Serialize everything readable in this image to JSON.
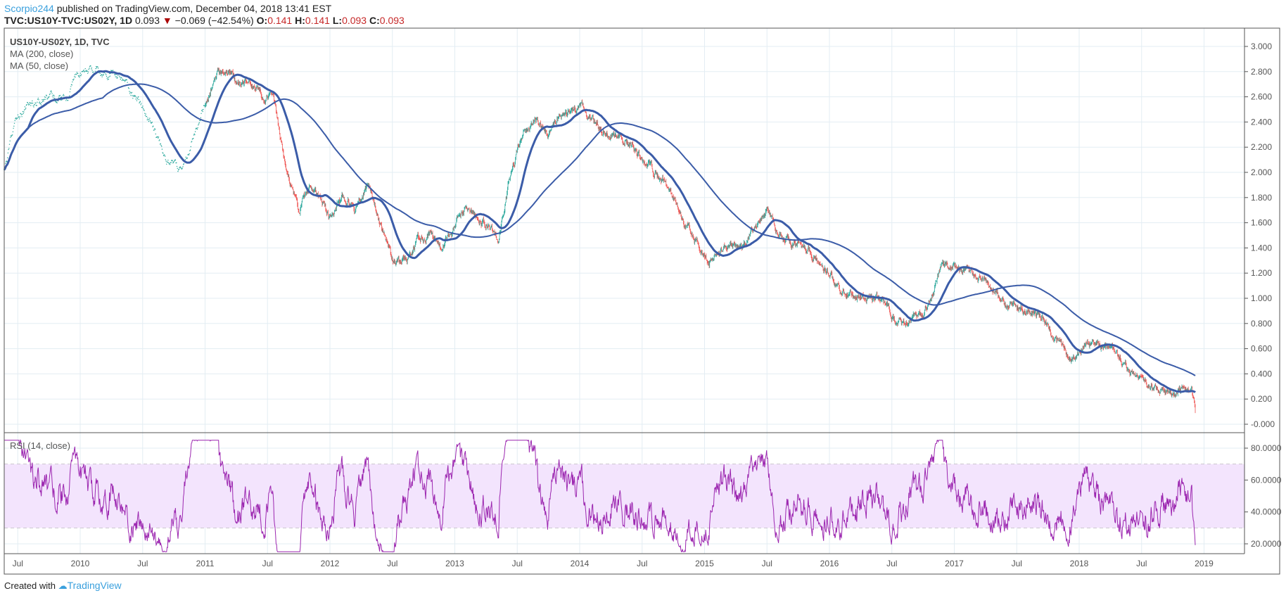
{
  "header": {
    "author": "Scorpio244",
    "published": "published on TradingView.com, December 04, 2018 13:41 EST",
    "symbol": "TVC:US10Y-TVC:US02Y, 1D",
    "last": "0.093",
    "change": "−0.069 (−42.54%)",
    "o_label": "O:",
    "o": "0.141",
    "h_label": "H:",
    "h": "0.141",
    "l_label": "L:",
    "l": "0.093",
    "c_label": "C:",
    "c": "0.093"
  },
  "legend": {
    "main": "US10Y-US02Y, 1D, TVC",
    "ma200": "MA (200, close)",
    "ma50": "MA (50, close)",
    "rsi": "RSI (14, close)"
  },
  "footer": {
    "created": "Created with",
    "brand": "TradingView"
  },
  "colors": {
    "up": "#26a69a",
    "down": "#ef5350",
    "ma": "#3b5ca8",
    "rsi": "#9c27b0",
    "band": "#f3e4fd",
    "grid": "#e3edf3"
  },
  "chart_data": {
    "type": "candlestick",
    "title": "US10Y-US02Y, 1D, TVC",
    "price_ticks": [
      "3.000",
      "2.800",
      "2.600",
      "2.400",
      "2.200",
      "2.000",
      "1.800",
      "1.600",
      "1.400",
      "1.200",
      "1.000",
      "0.800",
      "0.600",
      "0.400",
      "0.200",
      "-0.000"
    ],
    "rsi_ticks": [
      "80.0000",
      "60.0000",
      "40.0000",
      "20.0000"
    ],
    "rsi_band": [
      30,
      70
    ],
    "ylim": [
      0,
      3
    ],
    "time_ticks": [
      {
        "t": 2009.5,
        "label": "Jul"
      },
      {
        "t": 2010,
        "label": "2010"
      },
      {
        "t": 2010.5,
        "label": "Jul"
      },
      {
        "t": 2011,
        "label": "2011"
      },
      {
        "t": 2011.5,
        "label": "Jul"
      },
      {
        "t": 2012,
        "label": "2012"
      },
      {
        "t": 2012.5,
        "label": "Jul"
      },
      {
        "t": 2013,
        "label": "2013"
      },
      {
        "t": 2013.5,
        "label": "Jul"
      },
      {
        "t": 2014,
        "label": "2014"
      },
      {
        "t": 2014.5,
        "label": "Jul"
      },
      {
        "t": 2015,
        "label": "2015"
      },
      {
        "t": 2015.5,
        "label": "Jul"
      },
      {
        "t": 2016,
        "label": "2016"
      },
      {
        "t": 2016.5,
        "label": "Jul"
      },
      {
        "t": 2017,
        "label": "2017"
      },
      {
        "t": 2017.5,
        "label": "Jul"
      },
      {
        "t": 2018,
        "label": "2018"
      },
      {
        "t": 2018.5,
        "label": "Jul"
      },
      {
        "t": 2019,
        "label": "2019"
      }
    ],
    "close_path": [
      [
        2009.39,
        2.0
      ],
      [
        2009.5,
        2.45
      ],
      [
        2009.6,
        2.55
      ],
      [
        2009.9,
        2.6
      ],
      [
        2010.0,
        2.8
      ],
      [
        2010.3,
        2.8
      ],
      [
        2010.5,
        2.5
      ],
      [
        2010.7,
        2.1
      ],
      [
        2010.8,
        2.0
      ],
      [
        2010.95,
        2.4
      ],
      [
        2011.1,
        2.8
      ],
      [
        2011.3,
        2.7
      ],
      [
        2011.5,
        2.6
      ],
      [
        2011.55,
        2.6
      ],
      [
        2011.65,
        2.0
      ],
      [
        2011.75,
        1.7
      ],
      [
        2011.85,
        1.9
      ],
      [
        2012.0,
        1.65
      ],
      [
        2012.1,
        1.8
      ],
      [
        2012.2,
        1.7
      ],
      [
        2012.3,
        1.9
      ],
      [
        2012.4,
        1.6
      ],
      [
        2012.5,
        1.3
      ],
      [
        2012.6,
        1.3
      ],
      [
        2012.7,
        1.45
      ],
      [
        2012.8,
        1.5
      ],
      [
        2012.9,
        1.4
      ],
      [
        2013.0,
        1.6
      ],
      [
        2013.1,
        1.7
      ],
      [
        2013.25,
        1.6
      ],
      [
        2013.35,
        1.5
      ],
      [
        2013.45,
        2.0
      ],
      [
        2013.55,
        2.3
      ],
      [
        2013.65,
        2.4
      ],
      [
        2013.75,
        2.3
      ],
      [
        2013.85,
        2.45
      ],
      [
        2014.0,
        2.55
      ],
      [
        2014.1,
        2.4
      ],
      [
        2014.2,
        2.35
      ],
      [
        2014.35,
        2.25
      ],
      [
        2014.45,
        2.2
      ],
      [
        2014.55,
        2.05
      ],
      [
        2014.7,
        1.9
      ],
      [
        2014.8,
        1.7
      ],
      [
        2014.9,
        1.5
      ],
      [
        2015.05,
        1.3
      ],
      [
        2015.15,
        1.4
      ],
      [
        2015.3,
        1.4
      ],
      [
        2015.45,
        1.6
      ],
      [
        2015.5,
        1.7
      ],
      [
        2015.6,
        1.5
      ],
      [
        2015.7,
        1.45
      ],
      [
        2015.8,
        1.4
      ],
      [
        2015.9,
        1.3
      ],
      [
        2016.0,
        1.2
      ],
      [
        2016.1,
        1.05
      ],
      [
        2016.25,
        1.0
      ],
      [
        2016.4,
        1.0
      ],
      [
        2016.5,
        0.85
      ],
      [
        2016.6,
        0.8
      ],
      [
        2016.7,
        0.85
      ],
      [
        2016.8,
        0.95
      ],
      [
        2016.9,
        1.25
      ],
      [
        2017.0,
        1.25
      ],
      [
        2017.15,
        1.2
      ],
      [
        2017.3,
        1.1
      ],
      [
        2017.4,
        0.95
      ],
      [
        2017.55,
        0.9
      ],
      [
        2017.7,
        0.85
      ],
      [
        2017.8,
        0.7
      ],
      [
        2017.95,
        0.55
      ],
      [
        2018.05,
        0.65
      ],
      [
        2018.2,
        0.6
      ],
      [
        2018.35,
        0.5
      ],
      [
        2018.45,
        0.4
      ],
      [
        2018.55,
        0.3
      ],
      [
        2018.65,
        0.25
      ],
      [
        2018.75,
        0.22
      ],
      [
        2018.8,
        0.3
      ],
      [
        2018.9,
        0.28
      ],
      [
        2018.93,
        0.1
      ]
    ],
    "ma_periods": [
      200,
      50
    ],
    "rsi_period": 14
  }
}
